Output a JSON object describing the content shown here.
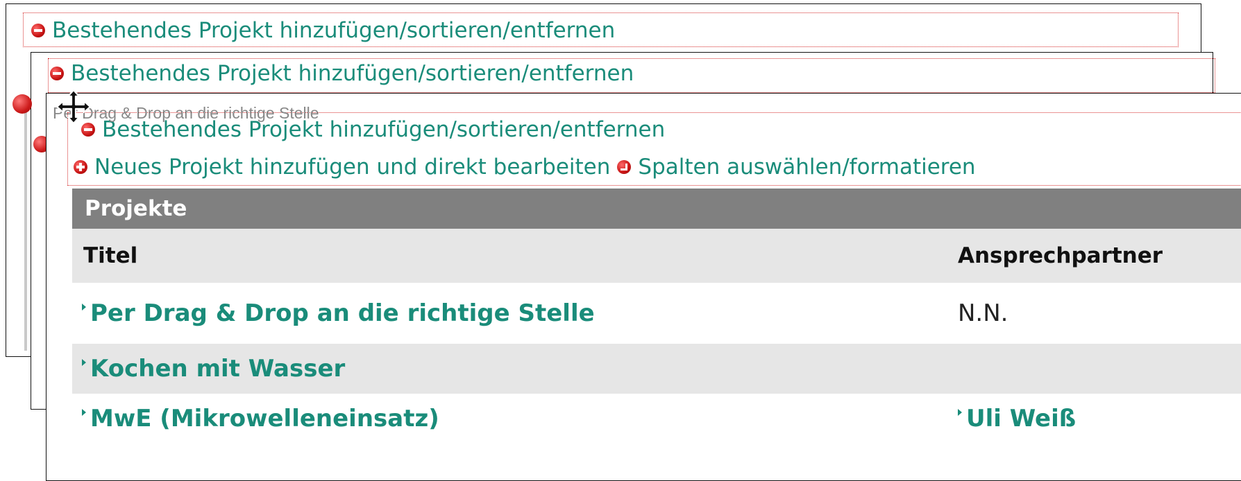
{
  "layers": [
    {
      "action_text": "Bestehendes Projekt hinzufügen/sortieren/entfernen"
    },
    {
      "action_text": "Bestehendes Projekt hinzufügen/sortieren/entfernen"
    },
    {
      "action_text": "Bestehendes Projekt hinzufügen/sortieren/entfernen"
    }
  ],
  "toolbar": {
    "new_project": "Neues Projekt hinzufügen und direkt bearbeiten",
    "columns": "Spalten auswählen/formatieren"
  },
  "drag_ghost_text": "Per Drag & Drop an die richtige Stelle",
  "panel": {
    "title": "Projekte",
    "columns": [
      "Titel",
      "Ansprechpartner"
    ],
    "rows": [
      {
        "title": "Per Drag & Drop an die richtige Stelle",
        "contact": "N.N.",
        "contact_linked": false
      },
      {
        "title": "Kochen mit Wasser",
        "contact": "",
        "contact_linked": false
      },
      {
        "title": "MwE (Mikrowelleneinsatz)",
        "contact": "Uli Weiß",
        "contact_linked": true
      }
    ]
  },
  "icons": [
    "minus-circle-icon",
    "plus-circle-icon",
    "arrow-circle-icon",
    "move-cursor-icon",
    "bullet-icon",
    "link-triangle-icon"
  ],
  "colors": {
    "link": "#1a8c7a",
    "panel_header": "#808080",
    "row_alt": "#e6e6e6",
    "dotted_border": "#d52a2a",
    "icon_red": "#c81414"
  }
}
